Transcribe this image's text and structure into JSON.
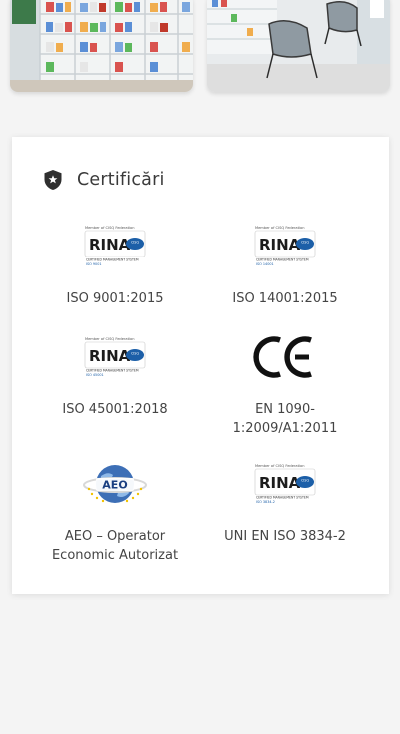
{
  "section": {
    "title": "Certificări",
    "icon": "shield-star-icon"
  },
  "certificates": [
    {
      "label": "ISO 9001:2015",
      "logo": "rina-logo",
      "logo_text": "RINA",
      "logo_small": "ISO 9001"
    },
    {
      "label": "ISO 14001:2015",
      "logo": "rina-logo",
      "logo_text": "RINA",
      "logo_small": "ISO 14001"
    },
    {
      "label": "ISO 45001:2018",
      "logo": "rina-logo",
      "logo_text": "RINA",
      "logo_small": "ISO 45001"
    },
    {
      "label": "EN 1090-1:2009/A1:2011",
      "logo": "ce-mark-icon",
      "logo_text": "CE"
    },
    {
      "label": "AEO – Operator Economic Autorizat",
      "logo": "aeo-globe-logo",
      "logo_text": "AEO"
    },
    {
      "label": "UNI EN ISO 3834-2",
      "logo": "rina-logo",
      "logo_text": "RINA",
      "logo_small": "ISO 3834-2"
    }
  ],
  "colors": {
    "rina_blue": "#1c5fa8",
    "text": "#444444",
    "card_bg": "#ffffff",
    "page_bg": "#f4f4f4"
  }
}
